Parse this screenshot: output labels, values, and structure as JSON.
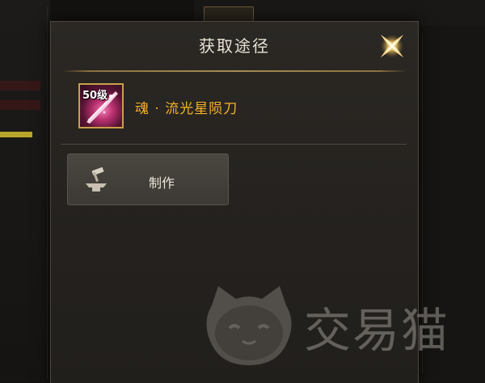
{
  "dialog": {
    "title": "获取途径",
    "close_icon": "close-x-star-icon"
  },
  "item": {
    "level_badge": "50级",
    "name": "魂 · 流光星陨刀",
    "name_color": "#f3b228",
    "icon": "sword-item-icon"
  },
  "sources": [
    {
      "label": "制作",
      "icon": "anvil-hammer-icon"
    }
  ],
  "watermark": {
    "text": "交易猫",
    "logo": "cat-face-logo-icon"
  },
  "colors": {
    "accent_gold": "#c9a04a",
    "panel_bg": "#2b2824"
  }
}
